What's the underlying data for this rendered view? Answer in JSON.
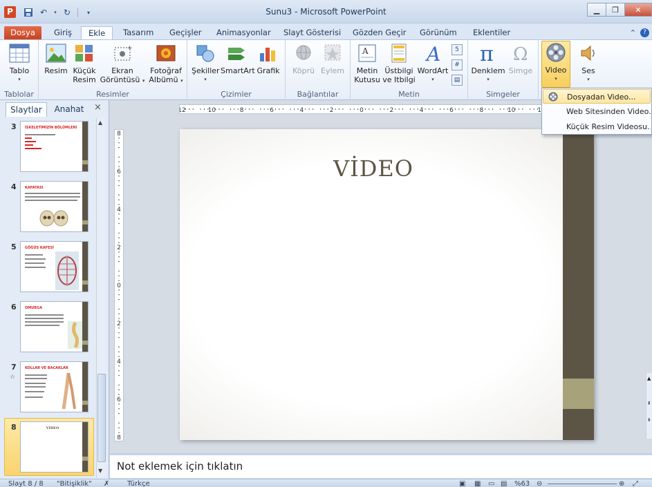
{
  "window": {
    "title": "Sunu3 - Microsoft PowerPoint",
    "app_icon_letter": "P"
  },
  "tabs": [
    {
      "label": "Dosya"
    },
    {
      "label": "Giriş"
    },
    {
      "label": "Ekle"
    },
    {
      "label": "Tasarım"
    },
    {
      "label": "Geçişler"
    },
    {
      "label": "Animasyonlar"
    },
    {
      "label": "Slayt Gösterisi"
    },
    {
      "label": "Gözden Geçir"
    },
    {
      "label": "Görünüm"
    },
    {
      "label": "Eklentiler"
    }
  ],
  "active_tab": "Ekle",
  "ribbon": {
    "groups": {
      "tablolar": "Tablolar",
      "resimler": "Resimler",
      "cizimler": "Çizimler",
      "baglantilar": "Bağlantılar",
      "metin": "Metin",
      "simgeler": "Simgeler"
    },
    "buttons": {
      "tablo": "Tablo",
      "resim": "Resim",
      "kucuk_resim_1": "Küçük",
      "kucuk_resim_2": "Resim",
      "ekran_1": "Ekran",
      "ekran_2": "Görüntüsü",
      "fotograf_1": "Fotoğraf",
      "fotograf_2": "Albümü",
      "sekiller": "Şekiller",
      "smartart": "SmartArt",
      "grafik": "Grafik",
      "kopru": "Köprü",
      "eylem": "Eylem",
      "metin_kutusu_1": "Metin",
      "metin_kutusu_2": "Kutusu",
      "ustbilgi_1": "Üstbilgi",
      "ustbilgi_2": "ve Itbilgi",
      "wordart": "WordArt",
      "denklem": "Denklem",
      "simge": "Simge",
      "video": "Video",
      "ses": "Ses"
    }
  },
  "video_menu": {
    "items": [
      {
        "label": "Dosyadan Video..."
      },
      {
        "label": "Web Sitesinden Video..."
      },
      {
        "label": "Küçük Resim Videosu..."
      }
    ]
  },
  "left_pane": {
    "tabs": {
      "slides": "Slaytlar",
      "outline": "Anahat"
    },
    "close": "×",
    "thumbnails": [
      {
        "number": "3",
        "title": "İSKELETİMİZİN BÖLÜMLERİ"
      },
      {
        "number": "4",
        "title": "KAFATASI"
      },
      {
        "number": "5",
        "title": "GÖĞÜS KAFESİ"
      },
      {
        "number": "6",
        "title": "OMURGA"
      },
      {
        "number": "7",
        "title": "KOLLAR VE BACAKLAR"
      },
      {
        "number": "8",
        "title": "VİDEO"
      }
    ],
    "selected_slide": "8"
  },
  "ruler": {
    "h_labels": [
      "12",
      "10",
      "8",
      "6",
      "4",
      "2",
      "0",
      "2",
      "4",
      "6",
      "8",
      "10",
      "12"
    ],
    "v_labels": [
      "8",
      "6",
      "4",
      "2",
      "0",
      "2",
      "4",
      "6",
      "8"
    ]
  },
  "slide": {
    "title": "VİDEO"
  },
  "notes": {
    "placeholder": "Not eklemek için tıklatın"
  },
  "status": {
    "slide": "Slayt 8 / 8",
    "theme": "\"Bitişiklik\"",
    "language": "Türkçe",
    "zoom": "%63"
  },
  "colors": {
    "slide_bar": "#5c5445",
    "slide_accent": "#a8a27a",
    "file_tab": "#c8401f",
    "selected_highlight": "#f8cf5d"
  }
}
